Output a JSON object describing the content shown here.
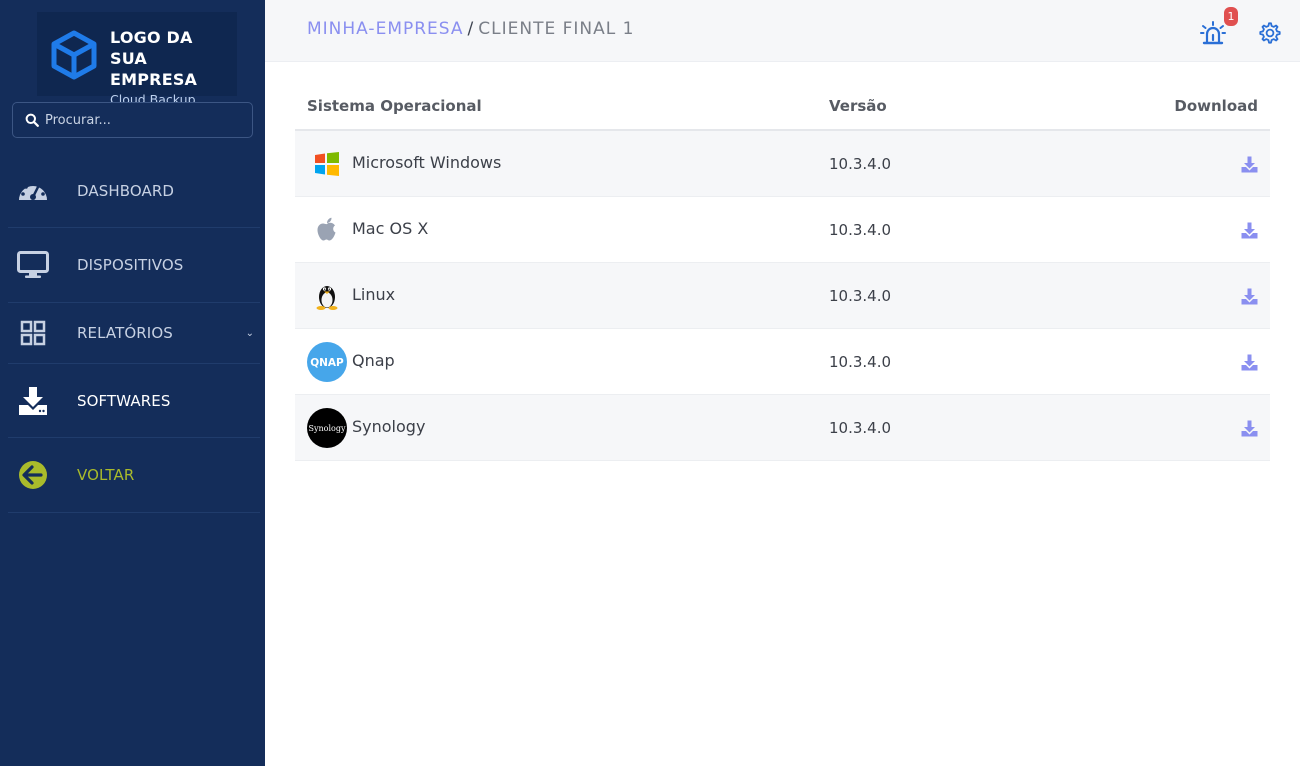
{
  "brand": {
    "line1": "LOGO DA",
    "line2": "SUA EMPRESA",
    "sub": "Cloud Backup"
  },
  "search": {
    "placeholder": "Procurar..."
  },
  "nav": {
    "items": [
      {
        "label": "DASHBOARD",
        "icon": "gauge-icon"
      },
      {
        "label": "DISPOSITIVOS",
        "icon": "monitor-icon"
      },
      {
        "label": "RELATÓRIOS",
        "icon": "grid-icon"
      },
      {
        "label": "SOFTWARES",
        "icon": "download-tray-icon"
      },
      {
        "label": "VOLTAR",
        "icon": "arrow-left-circle-icon"
      }
    ]
  },
  "header": {
    "breadcrumb_link": "MINHA-EMPRESA",
    "breadcrumb_sep": "/",
    "breadcrumb_current": "CLIENTE FINAL 1",
    "notification_count": "1"
  },
  "table": {
    "columns": [
      "Sistema Operacional",
      "Versão",
      "Download"
    ],
    "rows": [
      {
        "name": "Microsoft Windows",
        "version": "10.3.4.0",
        "logo": "windows-logo"
      },
      {
        "name": "Mac OS X",
        "version": "10.3.4.0",
        "logo": "apple-logo"
      },
      {
        "name": "Linux",
        "version": "10.3.4.0",
        "logo": "tux-logo"
      },
      {
        "name": "Qnap",
        "version": "10.3.4.0",
        "logo": "qnap-logo",
        "logo_text": "QNAP"
      },
      {
        "name": "Synology",
        "version": "10.3.4.0",
        "logo": "synology-logo",
        "logo_text": "Synology"
      }
    ]
  },
  "colors": {
    "sidebar": "#142d5a",
    "accent": "#8a8ff0",
    "back": "#a9bb2b",
    "badge": "#e05050",
    "icon_blue": "#2a6fd6"
  }
}
